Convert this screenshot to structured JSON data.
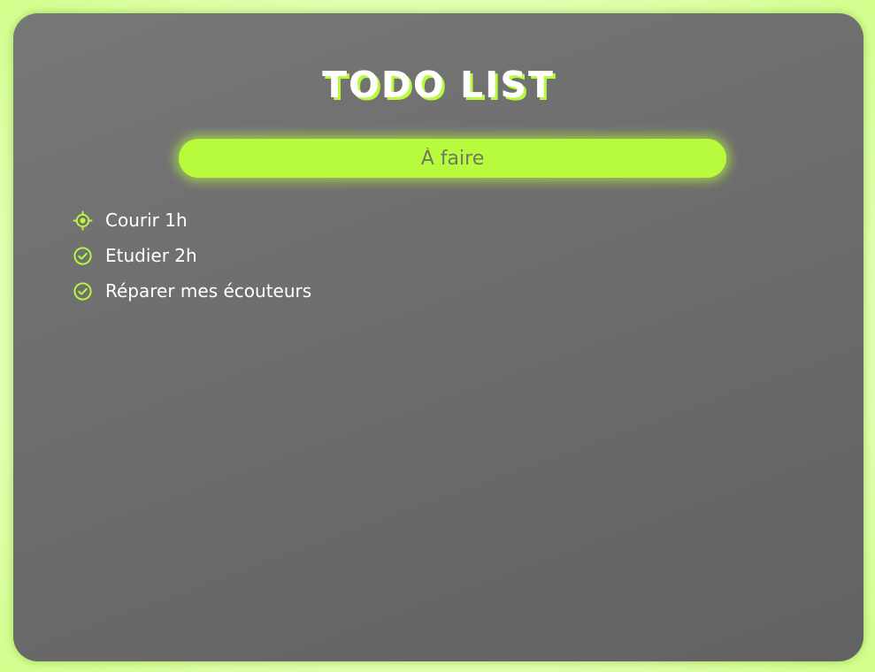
{
  "header": {
    "title": "TODO LIST"
  },
  "input": {
    "placeholder": "À faire",
    "value": ""
  },
  "todos": [
    {
      "label": "Courir 1h",
      "status": "in-progress",
      "icon": "target-icon"
    },
    {
      "label": "Etudier 2h",
      "status": "done",
      "icon": "check-circle-icon"
    },
    {
      "label": "Réparer mes écouteurs",
      "status": "done",
      "icon": "check-circle-icon"
    }
  ],
  "colors": {
    "accent": "#b8fb3c",
    "card": "#6d6d6d",
    "text": "#ffffff"
  }
}
